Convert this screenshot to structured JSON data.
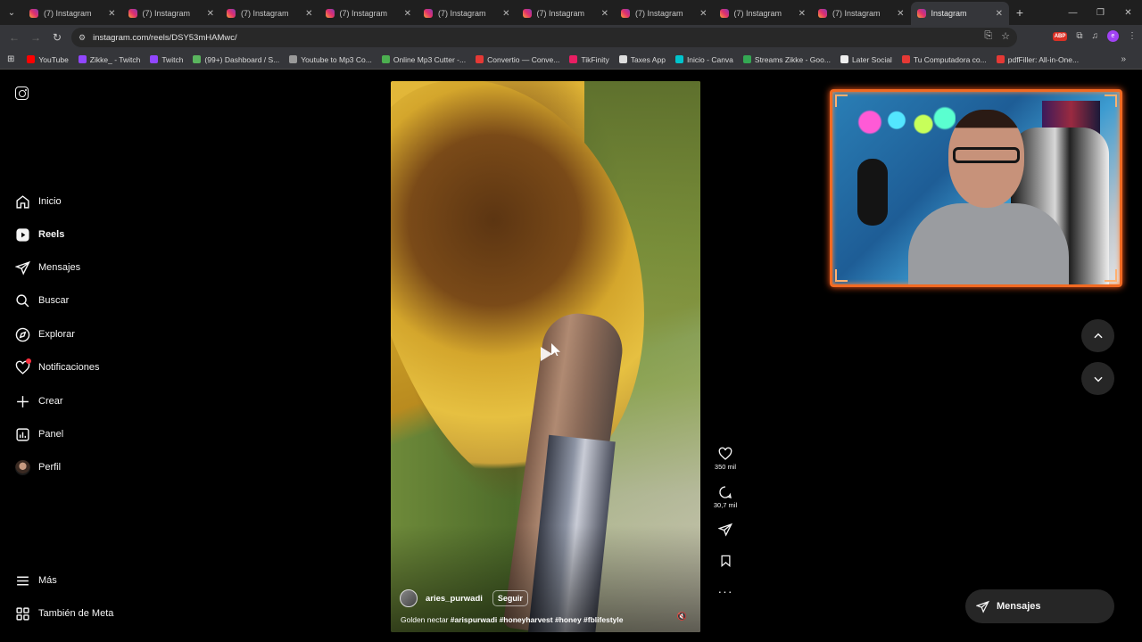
{
  "browser": {
    "tabs": [
      {
        "label": "(7) Instagram",
        "active": false
      },
      {
        "label": "(7) Instagram",
        "active": false
      },
      {
        "label": "(7) Instagram",
        "active": false
      },
      {
        "label": "(7) Instagram",
        "active": false
      },
      {
        "label": "(7) Instagram",
        "active": false
      },
      {
        "label": "(7) Instagram",
        "active": false
      },
      {
        "label": "(7) Instagram",
        "active": false
      },
      {
        "label": "(7) Instagram",
        "active": false
      },
      {
        "label": "(7) Instagram",
        "active": false
      },
      {
        "label": "Instagram",
        "active": true
      }
    ],
    "new_tab_symbol": "+",
    "url": "instagram.com/reels/DSY53mHAMwc/",
    "extension_badge": "ABP",
    "profile_initial": "e",
    "bookmarks": [
      {
        "label": "YouTube",
        "color": "#ff0000"
      },
      {
        "label": "Zikke_ - Twitch",
        "color": "#9146ff"
      },
      {
        "label": "Twitch",
        "color": "#9146ff"
      },
      {
        "label": "(99+) Dashboard / S...",
        "color": "#5ab55e"
      },
      {
        "label": "Youtube to Mp3 Co...",
        "color": "#999999"
      },
      {
        "label": "Online Mp3 Cutter -...",
        "color": "#4caf50"
      },
      {
        "label": "Convertio — Conve...",
        "color": "#e53935"
      },
      {
        "label": "TikFinity",
        "color": "#e91e63"
      },
      {
        "label": "Taxes App",
        "color": "#dddddd"
      },
      {
        "label": "Inicio - Canva",
        "color": "#00c4cc"
      },
      {
        "label": "Streams Zikke - Goo...",
        "color": "#34a853"
      },
      {
        "label": "Later Social",
        "color": "#eeeeee"
      },
      {
        "label": "Tu Computadora co...",
        "color": "#e53935"
      },
      {
        "label": "pdfFiller: All-in-One...",
        "color": "#e53935"
      }
    ]
  },
  "sidebar": {
    "items": [
      {
        "label": "Inicio",
        "icon": "home-icon"
      },
      {
        "label": "Reels",
        "icon": "reels-icon"
      },
      {
        "label": "Mensajes",
        "icon": "messages-icon"
      },
      {
        "label": "Buscar",
        "icon": "search-icon"
      },
      {
        "label": "Explorar",
        "icon": "explore-icon"
      },
      {
        "label": "Notificaciones",
        "icon": "heart-icon"
      },
      {
        "label": "Crear",
        "icon": "plus-icon"
      },
      {
        "label": "Panel",
        "icon": "dashboard-icon"
      },
      {
        "label": "Perfil",
        "icon": "profile-icon"
      }
    ],
    "bottom": [
      {
        "label": "Más",
        "icon": "menu-icon"
      },
      {
        "label": "También de Meta",
        "icon": "meta-icon"
      }
    ]
  },
  "reel": {
    "username": "aries_purwadi",
    "follow_label": "Seguir",
    "caption_text": "Golden nectar",
    "hashtags": "#arispurwadi #honeyharvest #honey #fblifestyle",
    "likes": "350 mil",
    "comments": "30,7 mil"
  },
  "messages_pill": {
    "label": "Mensajes"
  },
  "colors": {
    "accent_notification": "#ff3040",
    "webcam_frame": "#f26a22"
  }
}
